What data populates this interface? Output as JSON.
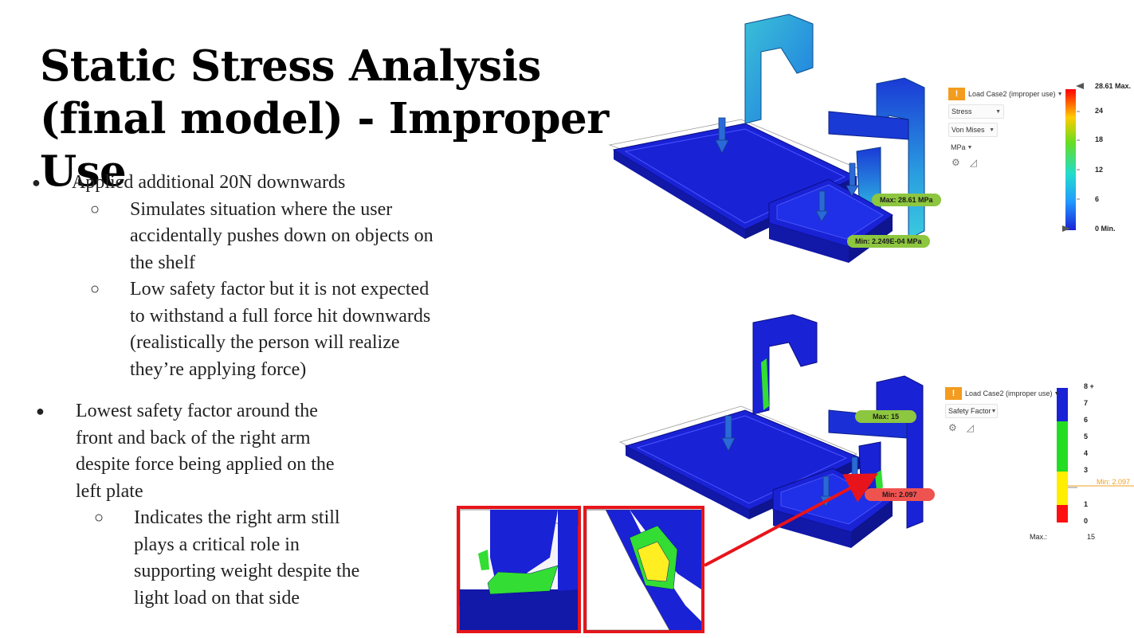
{
  "slide": {
    "title": "Static Stress Analysis (final model) - Improper Use",
    "bullets": {
      "b1": "Applied additional 20N downwards",
      "b1_sub1": [
        "Simulates situation where the user",
        "accidentally pushes down on objects on",
        "the shelf"
      ],
      "b1_sub2": [
        "Low safety factor but it is not expected",
        "to withstand a full force hit downwards",
        "(realistically the person will realize",
        "they’re applying force)"
      ],
      "b2": [
        "Lowest safety factor around the",
        "front and back of the right arm",
        "despite force being applied on the",
        "left plate"
      ],
      "b2_sub1": [
        "Indicates the right arm still",
        "plays a critical role in",
        "supporting weight despite the",
        "light load on that side"
      ]
    }
  },
  "stress_result": {
    "load_case": "Load Case2 (improper use)",
    "result_type": "Stress",
    "component": "Von Mises",
    "unit": "MPa",
    "legend_max": "28.61 Max.",
    "legend_min": "0 Min.",
    "ticks": [
      "24",
      "18",
      "12",
      "6"
    ],
    "max_tag": "Max: 28.61 MPa",
    "min_tag": "Min: 2.249E-04 MPa",
    "max_value": 28.61,
    "min_value": 0.0002249
  },
  "safety_result": {
    "load_case": "Load Case2 (improper use)",
    "result_type": "Safety Factor",
    "ticks": [
      "8 +",
      "7",
      "6",
      "5",
      "4",
      "3",
      "1",
      "0"
    ],
    "min_marker": "Min: 2.097",
    "max_label": "Max.:",
    "max_value": "15",
    "max_tag": "Max: 15",
    "min_tag": "Min: 2.097"
  },
  "colors": {
    "model_blue": "#1a22d6",
    "callout_red": "#e8141b",
    "tag_green": "#8dc63f",
    "tag_red": "#ef5350",
    "warning_orange": "#f39c1f",
    "min_marker": "#f0a020"
  },
  "icons": {
    "warning": "!",
    "gear": "⚙",
    "triangle": "◿"
  }
}
